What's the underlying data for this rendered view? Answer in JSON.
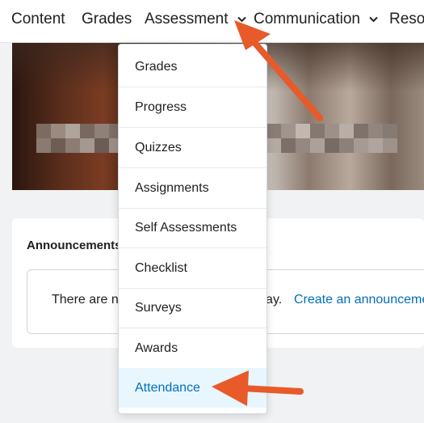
{
  "nav": {
    "items": [
      {
        "label": "Content"
      },
      {
        "label": "Grades"
      },
      {
        "label": "Assessment"
      },
      {
        "label": "Communication"
      },
      {
        "label": "Resou"
      }
    ]
  },
  "dropdown": {
    "items": [
      {
        "label": "Grades"
      },
      {
        "label": "Progress"
      },
      {
        "label": "Quizzes"
      },
      {
        "label": "Assignments"
      },
      {
        "label": "Self Assessments"
      },
      {
        "label": "Checklist"
      },
      {
        "label": "Surveys"
      },
      {
        "label": "Awards"
      },
      {
        "label": "Attendance",
        "active": true
      }
    ]
  },
  "announcements": {
    "title": "Announcements",
    "empty_text": "There are no announcements to display.",
    "create_link": "Create an announcement"
  },
  "colors": {
    "link": "#006fbf",
    "active_bg": "#e8f6fd",
    "arrow": "#e85a2a"
  }
}
